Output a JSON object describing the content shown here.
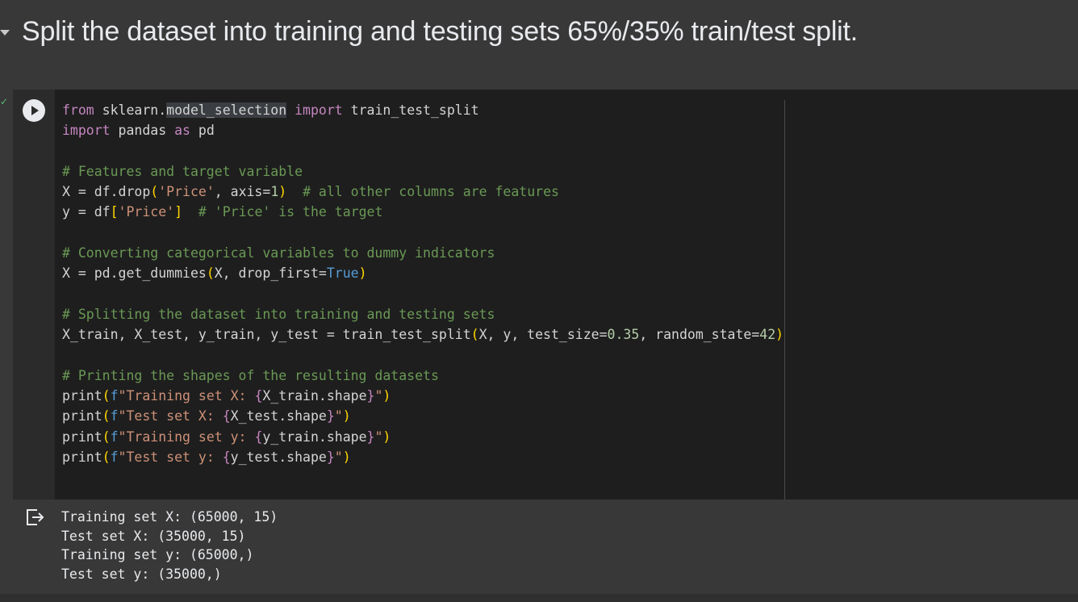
{
  "section": {
    "heading": "Split the dataset into training and testing sets 65%/35% train/test split."
  },
  "cell": {
    "run_icon": "play-icon",
    "code_lines": [
      "from sklearn.model_selection import train_test_split",
      "import pandas as pd",
      "",
      "# Features and target variable",
      "X = df.drop('Price', axis=1)  # all other columns are features",
      "y = df['Price']  # 'Price' is the target",
      "",
      "# Converting categorical variables to dummy indicators",
      "X = pd.get_dummies(X, drop_first=True)",
      "",
      "# Splitting the dataset into training and testing sets",
      "X_train, X_test, y_train, y_test = train_test_split(X, y, test_size=0.35, random_state=42)",
      "",
      "# Printing the shapes of the resulting datasets",
      "print(f\"Training set X: {X_train.shape}\")",
      "print(f\"Test set X: {X_test.shape}\")",
      "print(f\"Training set y: {y_train.shape}\")",
      "print(f\"Test set y: {y_test.shape}\")"
    ]
  },
  "output": {
    "icon": "output-redirect-icon",
    "lines": [
      "Training set X: (65000, 15)",
      "Test set X: (35000, 15)",
      "Training set y: (65000,)",
      "Test set y: (35000,)"
    ]
  },
  "colors": {
    "keyword": "#c586c0",
    "comment": "#6a9955",
    "string": "#ce9178",
    "number": "#b5cea8",
    "builtin_constant": "#569cd6",
    "bracket": "#ffd700",
    "status_ok": "#5bb974"
  }
}
